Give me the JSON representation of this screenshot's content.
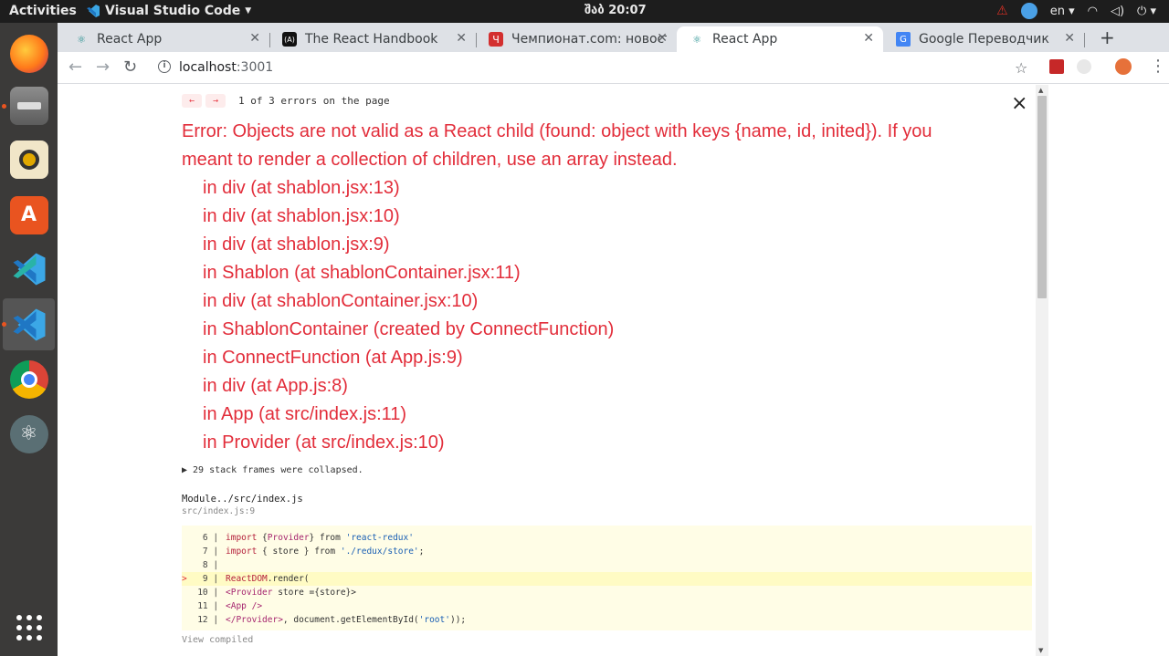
{
  "topbar": {
    "activities": "Activities",
    "app_name": "Visual Studio Code",
    "clock": "შაბ 20:07",
    "lang": "en"
  },
  "tabs": [
    {
      "title": "React App",
      "favicon": "react-icon",
      "active": false
    },
    {
      "title": "The React Handbook",
      "favicon": "handbook-icon",
      "active": false
    },
    {
      "title": "Чемпионат.com: новости",
      "favicon": "championat-icon",
      "active": false
    },
    {
      "title": "React App",
      "favicon": "react-icon",
      "active": true
    },
    {
      "title": "Google Переводчик",
      "favicon": "google-translate-icon",
      "active": false
    }
  ],
  "address": {
    "host": "localhost",
    "port": ":3001"
  },
  "overlay": {
    "prev_arrow": "←",
    "next_arrow": "→",
    "error_count": "1 of 3 errors on the page",
    "close": "×",
    "error_title": "Error: Objects are not valid as a React child (found: object with keys {name, id, inited}). If you meant to render a collection of children, use an array instead.",
    "stack": [
      "in div (at shablon.jsx:13)",
      "in div (at shablon.jsx:10)",
      "in div (at shablon.jsx:9)",
      "in Shablon (at shablonContainer.jsx:11)",
      "in div (at shablonContainer.jsx:10)",
      "in ShablonContainer (created by ConnectFunction)",
      "in ConnectFunction (at App.js:9)",
      "in div (at App.js:8)",
      "in App (at src/index.js:11)",
      "in Provider (at src/index.js:10)"
    ],
    "collapsed": "▶ 29 stack frames were collapsed.",
    "module": "Module../src/index.js",
    "module_src": "src/index.js:9",
    "view_compiled": "View compiled"
  },
  "code_lines": [
    {
      "num": "6",
      "marker": "",
      "highlight": false
    },
    {
      "num": "7",
      "marker": "",
      "highlight": false
    },
    {
      "num": "8",
      "marker": "",
      "highlight": false
    },
    {
      "num": "9",
      "marker": ">",
      "highlight": true
    },
    {
      "num": "10",
      "marker": "",
      "highlight": false
    },
    {
      "num": "11",
      "marker": "",
      "highlight": false
    },
    {
      "num": "12",
      "marker": "",
      "highlight": false
    }
  ],
  "code_tokens": {
    "l6_kw": "import",
    "l6_p1": " {",
    "l6_id": "Provider",
    "l6_p2": "} from ",
    "l6_str": "'react-redux'",
    "l7_kw": "import",
    "l7_p1": " { store } from ",
    "l7_str": "'./redux/store'",
    "l7_end": ";",
    "l9_obj": "ReactDOM",
    "l9_call": ".render(",
    "l10_tag": "<Provider",
    "l10_rest": " store ={store}>",
    "l11_tag": "<App />",
    "l12_tag": "</Provider>",
    "l12_mid": ", document.getElementById(",
    "l12_str": "'root'",
    "l12_end": "));"
  },
  "colors": {
    "error_red": "#e22d3a",
    "dock_bg": "#3b3a39",
    "topbar_bg": "#1d1d1d",
    "tab_strip": "#dee1e6"
  }
}
